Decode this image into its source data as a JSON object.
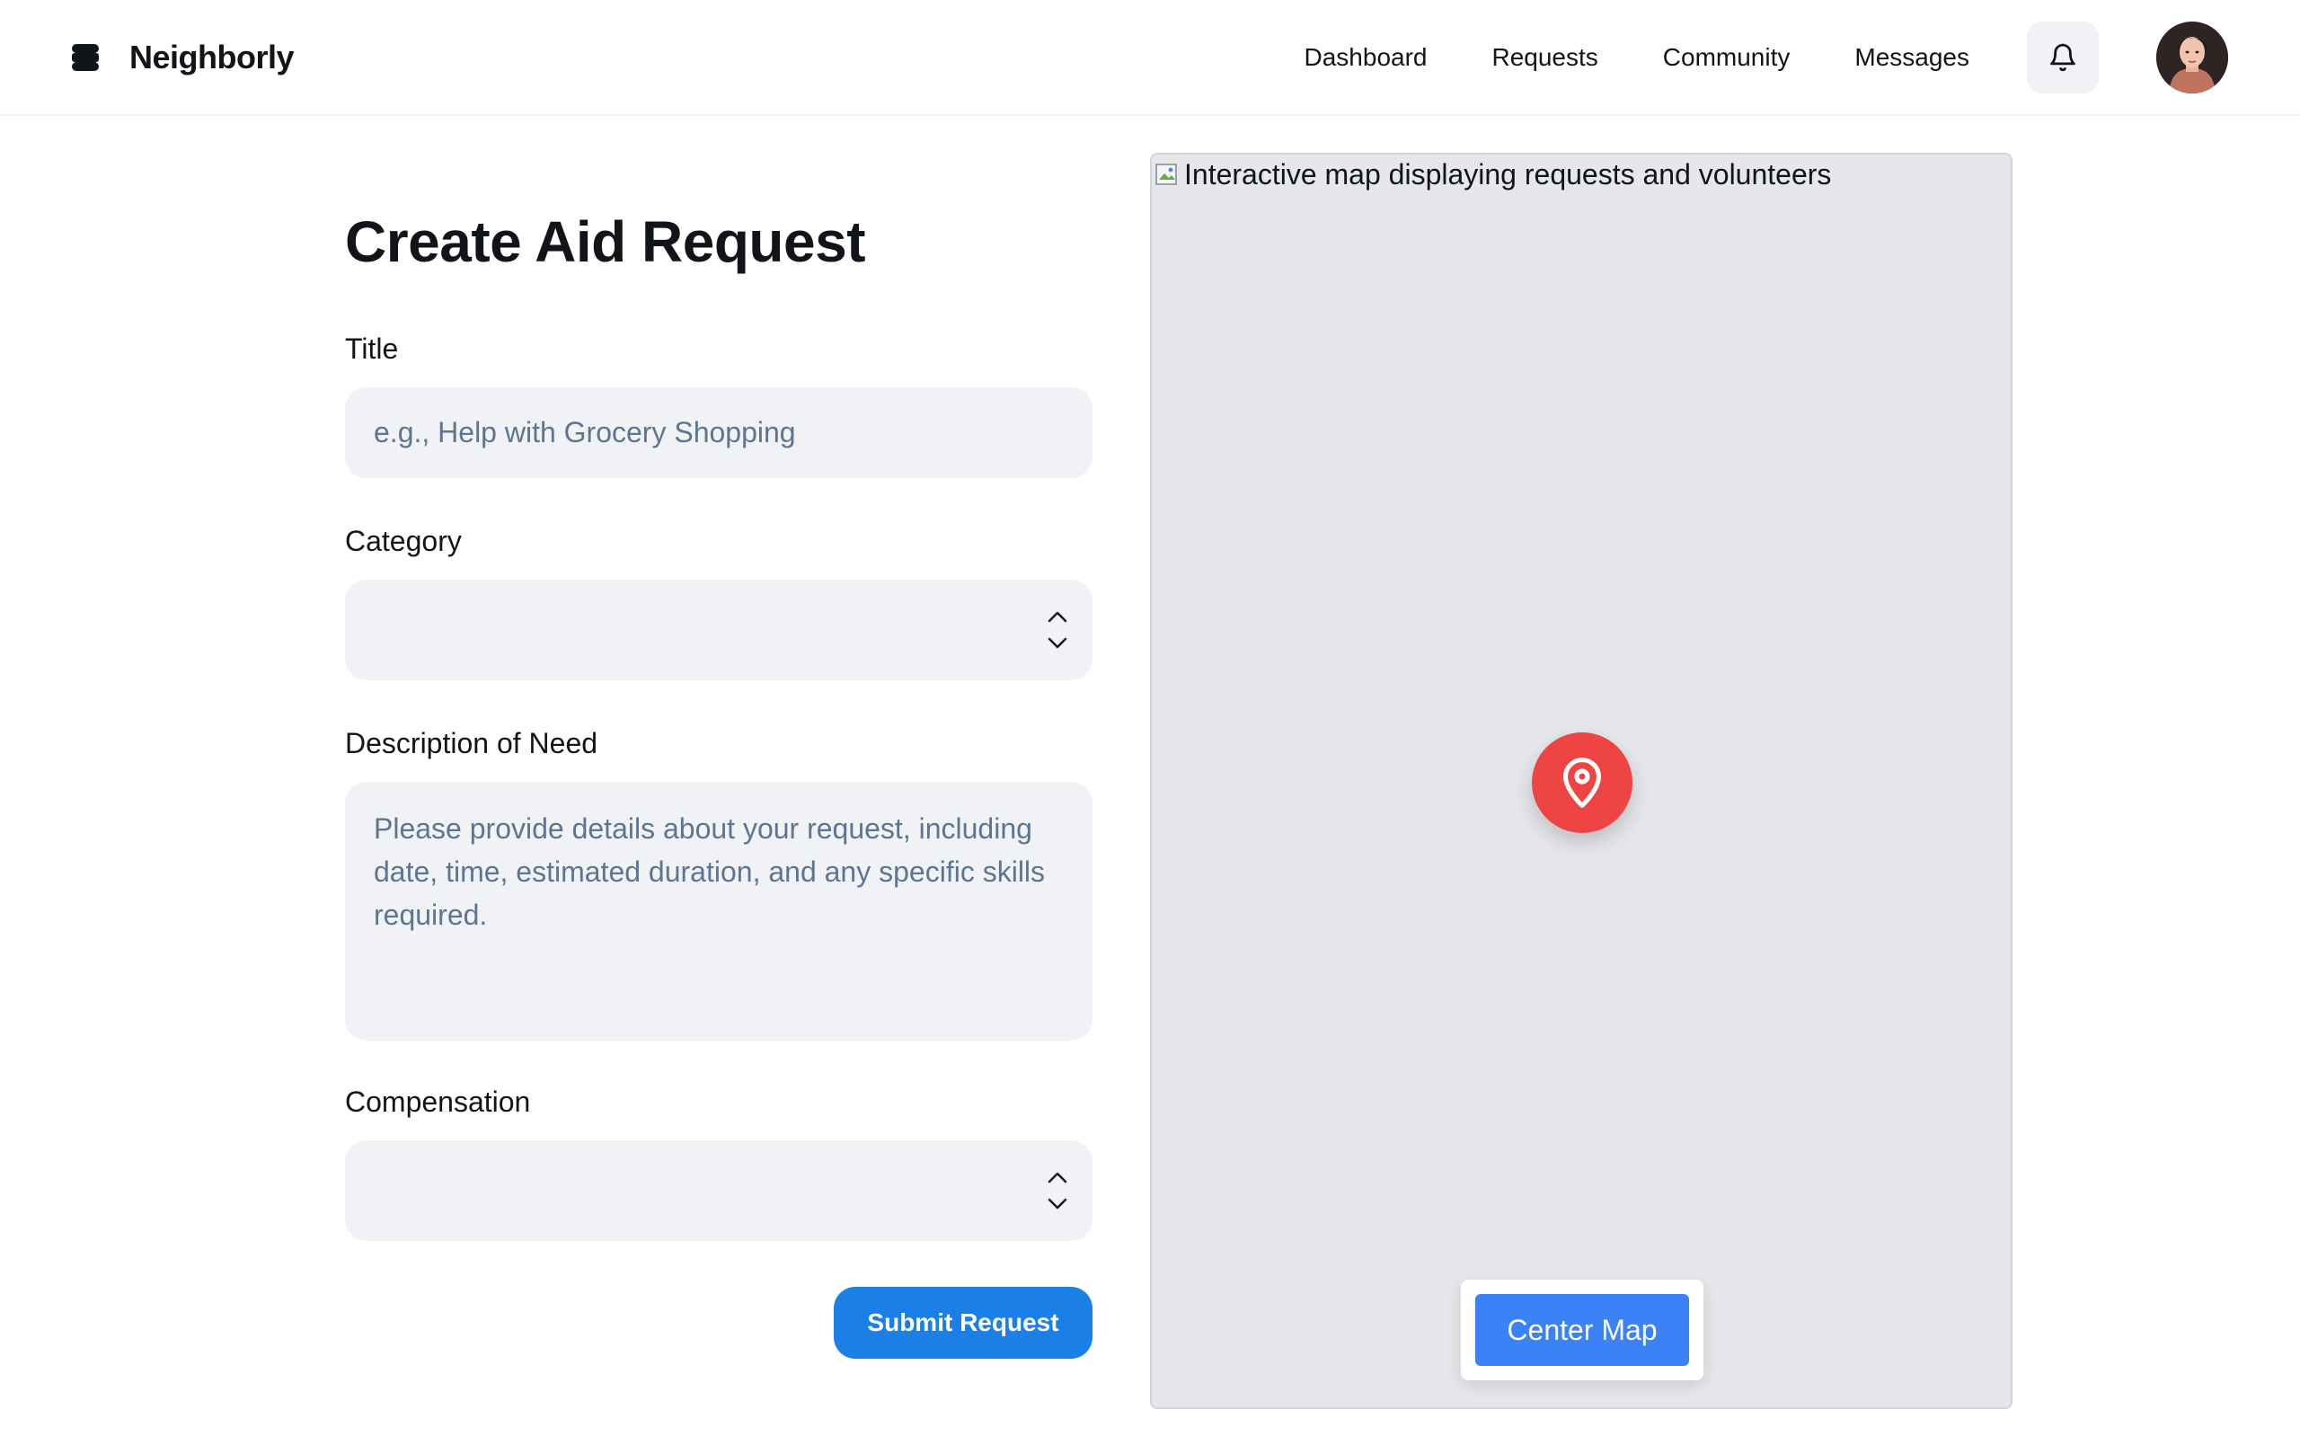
{
  "header": {
    "brand_name": "Neighborly",
    "nav": [
      "Dashboard",
      "Requests",
      "Community",
      "Messages"
    ],
    "notification_icon": "bell-icon",
    "avatar_icon": "user-avatar"
  },
  "form": {
    "title": "Create Aid Request",
    "title_label": "Title",
    "title_placeholder": "e.g., Help with Grocery Shopping",
    "category_label": "Category",
    "category_value": "",
    "description_label": "Description of Need",
    "description_placeholder": "Please provide details about your request, including date, time, estimated duration, and any specific skills required.",
    "compensation_label": "Compensation",
    "compensation_value": "",
    "submit_label": "Submit Request"
  },
  "map": {
    "alt_text": "Interactive map displaying requests and volunteers",
    "pin_icon": "map-pin-icon",
    "center_button_label": "Center Map"
  },
  "colors": {
    "primary": "#1a7fe6",
    "map_button": "#3b82f6",
    "pin": "#ef4444",
    "field_bg": "#f0f2f5",
    "placeholder": "#5d7590"
  }
}
